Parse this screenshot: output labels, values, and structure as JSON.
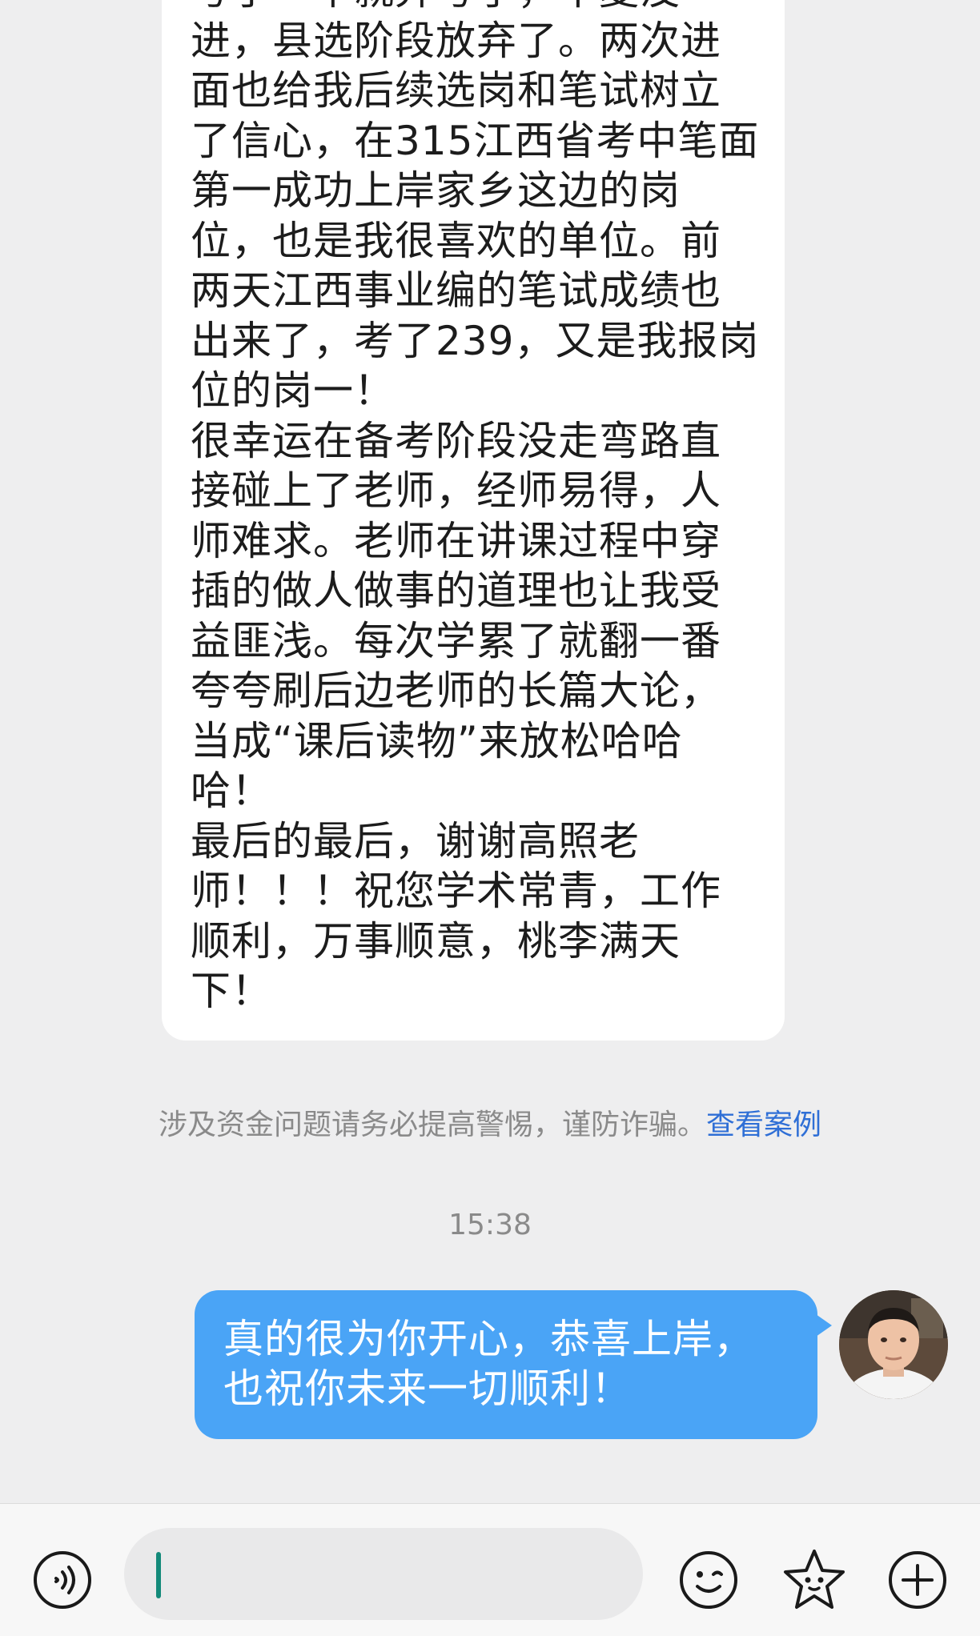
{
  "incoming_message": {
    "text": "考了一半就弃考了，中夏没进，县选阶段放弃了。两次进面也给我后续选岗和笔试树立了信心，在315江西省考中笔面第一成功上岸家乡这边的岗位，也是我很喜欢的单位。前两天江西事业编的笔试成绩也出来了，考了239，又是我报岗位的岗一！\n很幸运在备考阶段没走弯路直接碰上了老师，经师易得，人师难求。老师在讲课过程中穿插的做人做事的道理也让我受益匪浅。每次学累了就翻一番夸夸刷后边老师的长篇大论，当成“课后读物”来放松哈哈哈！\n最后的最后，谢谢高照老师！！！祝您学术常青，工作顺利，万事顺意，桃李满天下！"
  },
  "notice": {
    "text": "涉及资金问题请务必提高警惕，谨防诈骗。",
    "link_label": "查看案例"
  },
  "timestamp": "15:38",
  "outgoing_message": {
    "text": "真的很为你开心，恭喜上岸，\n也祝你未来一切顺利！"
  },
  "input_bar": {
    "placeholder": "",
    "value": ""
  },
  "icons": {
    "voice": "voice-icon",
    "emoji": "emoji-icon",
    "sticker": "sticker-icon",
    "more": "plus-icon"
  },
  "colors": {
    "outgoing_bubble": "#4aa4f6",
    "incoming_bubble": "#ffffff",
    "background": "#eeeeef",
    "link": "#2f6fd6",
    "cursor": "#138a7a"
  }
}
